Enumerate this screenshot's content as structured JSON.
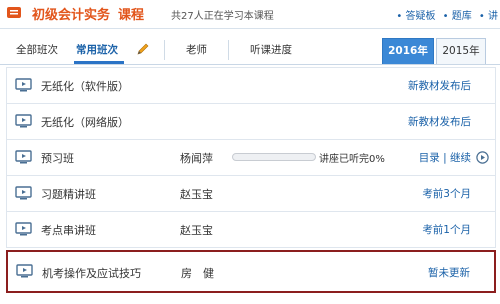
{
  "header": {
    "title_part1": "初级会计实务",
    "title_part2": "课程",
    "subtitle": "共27人正在学习本课程",
    "links": [
      "• 答疑板",
      "• 题库",
      "• 讲"
    ]
  },
  "tabs": {
    "all_classes": "全部班次",
    "common_classes": "常用班次",
    "teacher": "老师",
    "progress": "听课进度",
    "years": [
      "2016年",
      "2015年"
    ],
    "active_year": "2016年"
  },
  "courses": [
    {
      "name": "无纸化（软件版）",
      "teacher": "",
      "status": "新教材发布后"
    },
    {
      "name": "无纸化（网络版）",
      "teacher": "",
      "status": "新教材发布后"
    },
    {
      "name": "预习班",
      "teacher": "杨闻萍",
      "progress_fraction": 0.0,
      "progress_text": "讲座已听完0%",
      "links": "目录 | 继续"
    },
    {
      "name": "习题精讲班",
      "teacher": "赵玉宝",
      "status": "考前3个月"
    },
    {
      "name": "考点串讲班",
      "teacher": "赵玉宝",
      "status": "考前1个月"
    },
    {
      "name": "机考操作及应试技巧",
      "teacher": "房　健",
      "status": "暂未更新"
    }
  ],
  "colors": {
    "accent": "#e2551b",
    "link": "#1a61a8",
    "highlight_border": "#8b1e1e",
    "year_active": "#3b88d6"
  }
}
